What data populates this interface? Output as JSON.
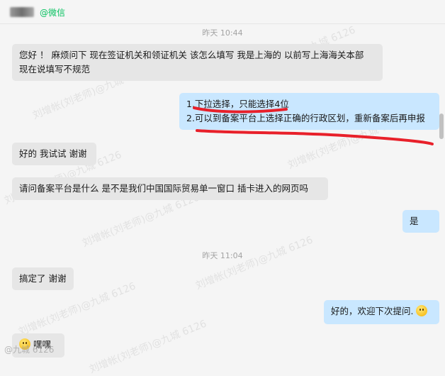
{
  "header": {
    "contact_name": "",
    "source": "@微信"
  },
  "messages": [
    {
      "type": "time",
      "text": "昨天 10:44"
    },
    {
      "type": "in",
      "lines": [
        "您好 ！ 麻烦问下 现在签证机关和领证机关 该怎么填写 我是上海的 以前写上海海关本部",
        "现在说填写不规范"
      ]
    },
    {
      "type": "out",
      "lines": [
        "1.下拉选择，只能选择4位",
        "2.可以到备案平台上选择正确的行政区划，重新备案后再申报"
      ]
    },
    {
      "type": "in",
      "lines": [
        "好的 我试试 谢谢"
      ]
    },
    {
      "type": "in",
      "lines": [
        "请问备案平台是什么 是不是我们中国国际贸易单一窗口 插卡进入的网页吗"
      ]
    },
    {
      "type": "out",
      "lines": [
        "是"
      ]
    },
    {
      "type": "time",
      "text": "昨天 11:04"
    },
    {
      "type": "in",
      "lines": [
        "搞定了 谢谢"
      ]
    },
    {
      "type": "out",
      "lines": [
        "好的，欢迎下次提问."
      ],
      "emoji": "smile-emoji"
    },
    {
      "type": "in",
      "lines": [
        "嘿嘿"
      ],
      "emoji": "grin-emoji"
    }
  ],
  "watermark": "刘增帐(刘老师)@九城 6126",
  "bottom_watermark": "@九城 6126",
  "colors": {
    "incoming": "#e6e6e6",
    "outgoing": "#c9e7ff",
    "annotation": "#e8202a",
    "source": "#07c160"
  }
}
